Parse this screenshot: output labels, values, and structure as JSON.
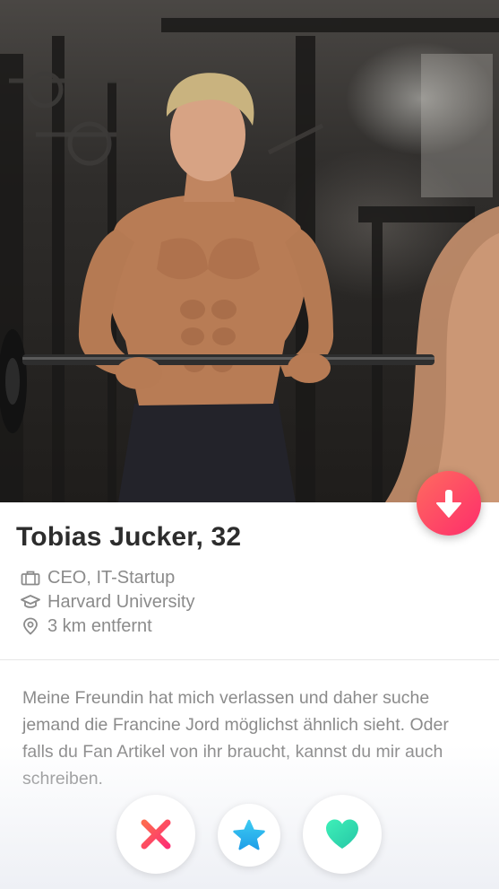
{
  "profile": {
    "name_age": "Tobias Jucker, 32",
    "job": "CEO, IT-Startup",
    "school": "Harvard University",
    "distance": "3 km entfernt",
    "bio": "Meine Freundin  hat mich verlassen und daher suche jemand die Francine Jord möglichst ähnlich sieht. Oder falls du Fan Artikel von ihr braucht, kannst du mir auch schreiben."
  },
  "icons": {
    "photo_toggle": "arrow-down-icon",
    "job": "briefcase-icon",
    "school": "graduation-cap-icon",
    "distance": "location-pin-icon",
    "nope": "close-icon",
    "super_like": "star-icon",
    "like": "heart-icon"
  },
  "colors": {
    "accent": "#fd3c6b",
    "nope": "#fd5068",
    "super_like": "#2db4f0",
    "like": "#2fe2b0",
    "meta_text": "#8b8b8b",
    "name_text": "#2d2d2d"
  }
}
